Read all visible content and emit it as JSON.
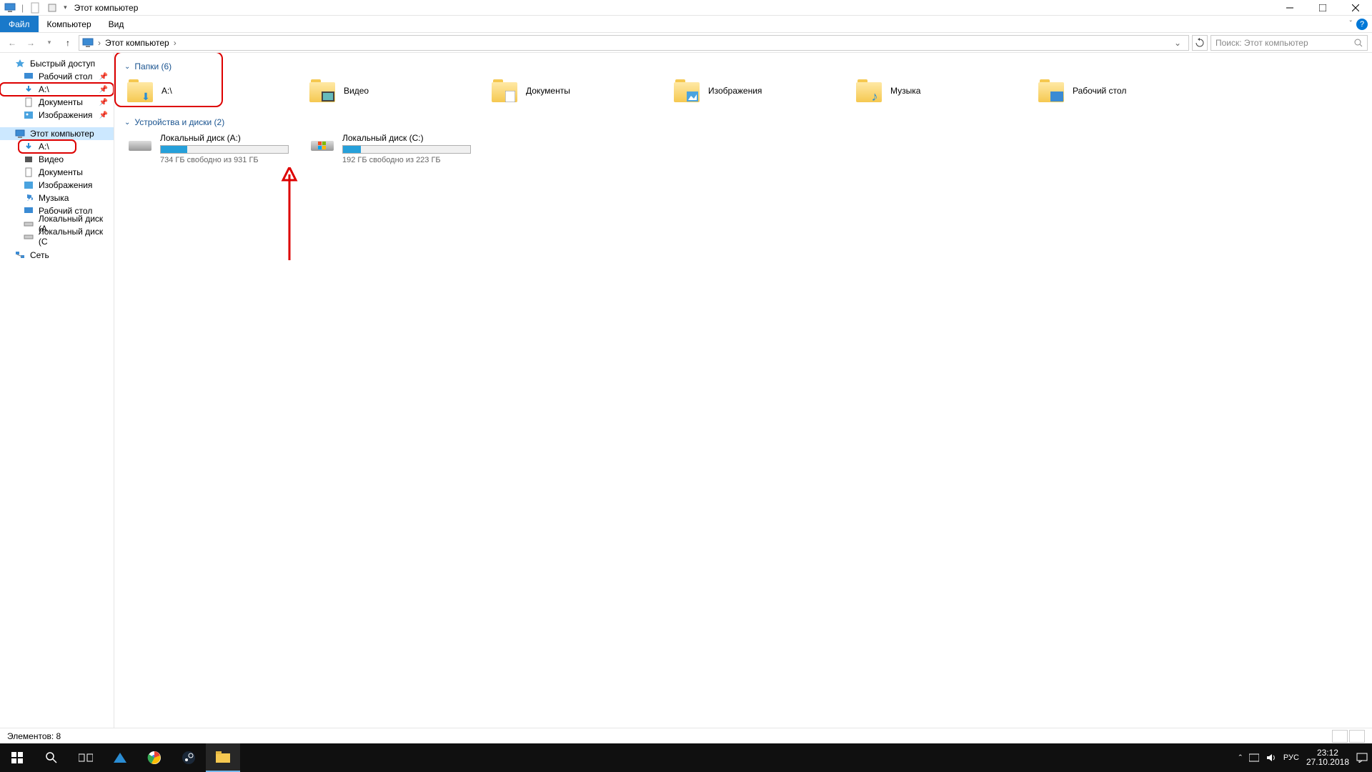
{
  "window": {
    "title": "Этот компьютер",
    "controls": {
      "min": "—",
      "max": "❐",
      "close": "✕"
    }
  },
  "ribbon": {
    "file": "Файл",
    "computer": "Компьютер",
    "view": "Вид"
  },
  "nav": {
    "breadcrumb_root": "Этот компьютер",
    "search_placeholder": "Поиск: Этот компьютер"
  },
  "sidebar": {
    "quick_access": "Быстрый доступ",
    "desktop": "Рабочий стол",
    "a_drive": "A:\\",
    "documents": "Документы",
    "pictures": "Изображения",
    "this_pc": "Этот компьютер",
    "a_drive2": "A:\\",
    "videos": "Видео",
    "documents2": "Документы",
    "pictures2": "Изображения",
    "music": "Музыка",
    "desktop2": "Рабочий стол",
    "local_disk_a": "Локальный диск (A",
    "local_disk_c": "Локальный диск (C",
    "network": "Сеть"
  },
  "content": {
    "folders_header": "Папки (6)",
    "drives_header": "Устройства и диски (2)",
    "folders": [
      {
        "name": "A:\\",
        "overlay": "download"
      },
      {
        "name": "Видео",
        "overlay": "video"
      },
      {
        "name": "Документы",
        "overlay": "docs"
      },
      {
        "name": "Изображения",
        "overlay": "pics"
      },
      {
        "name": "Музыка",
        "overlay": "music"
      },
      {
        "name": "Рабочий стол",
        "overlay": "desktop"
      }
    ],
    "drives": [
      {
        "name": "Локальный диск (A:)",
        "free_text": "734 ГБ свободно из 931 ГБ",
        "fill_pct": 21
      },
      {
        "name": "Локальный диск (C:)",
        "free_text": "192 ГБ свободно из 223 ГБ",
        "fill_pct": 14
      }
    ]
  },
  "status": {
    "items": "Элементов: 8"
  },
  "taskbar": {
    "lang": "РУС",
    "time": "23:12",
    "date": "27.10.2018"
  }
}
